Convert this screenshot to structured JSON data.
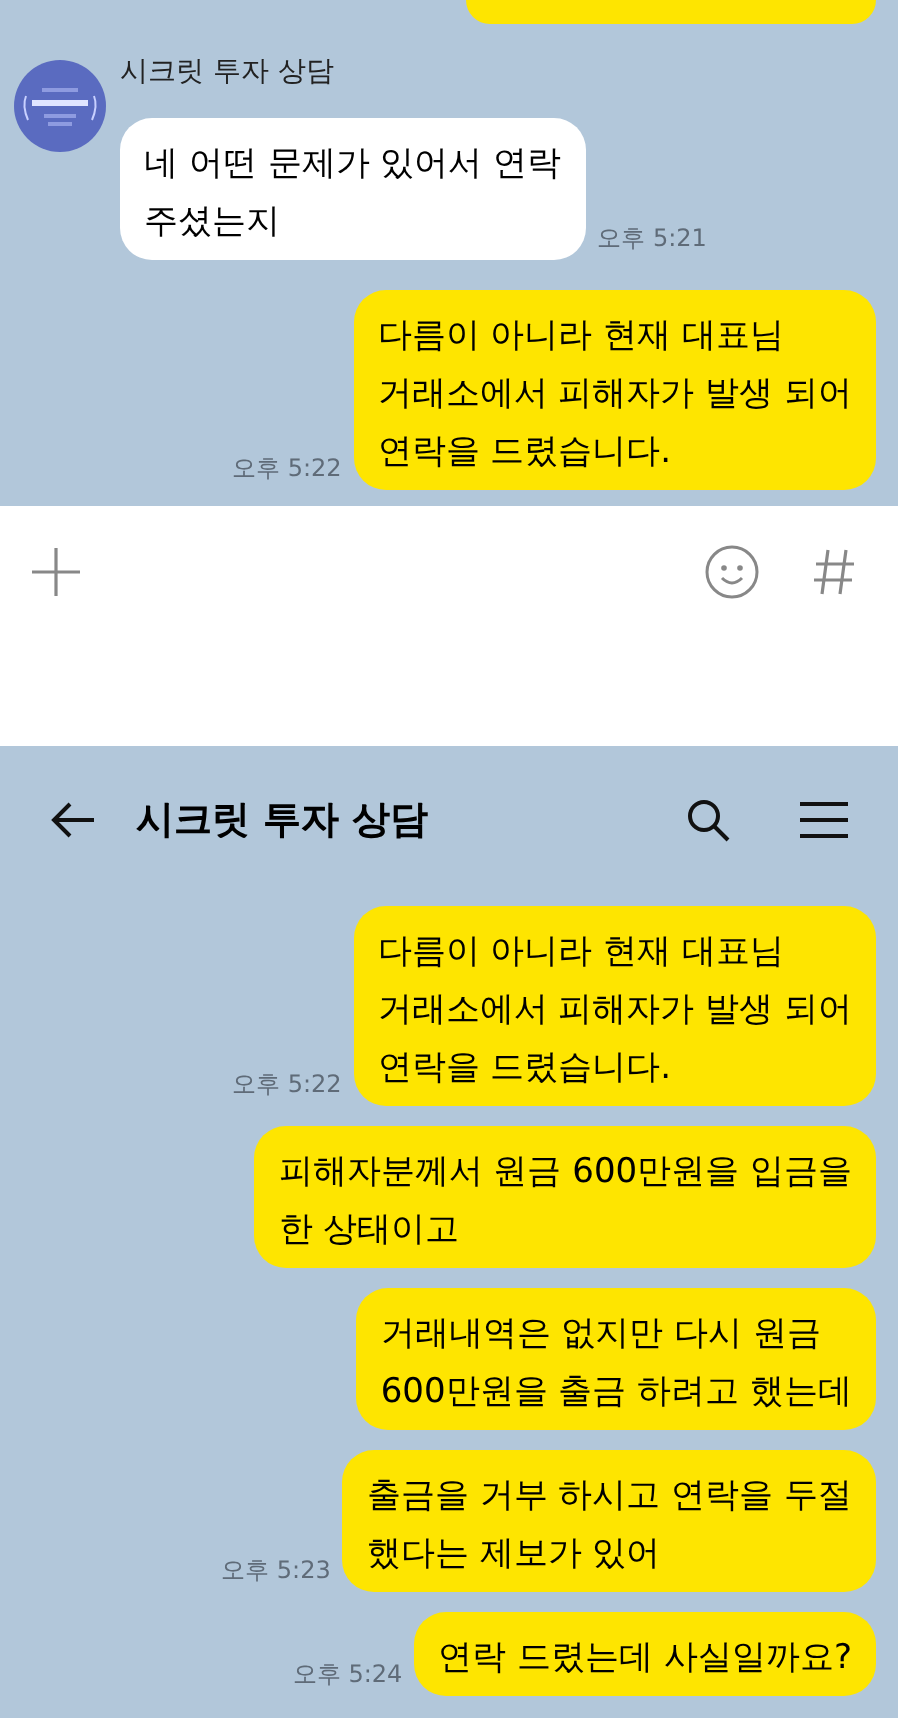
{
  "top_screen": {
    "messages": [
      {
        "kind": "received",
        "sender": "시크릿 투자 상담",
        "text": "네 어떤 문제가 있어서 연락\n주셨는지",
        "time": "오후 5:21"
      },
      {
        "kind": "sent",
        "text": "다름이 아니라 현재 대표님\n거래소에서 피해자가 발생 되어\n연락을 드렸습니다.",
        "time": "오후 5:22"
      }
    ]
  },
  "bottom_screen": {
    "header": {
      "title": "시크릿 투자 상담"
    },
    "messages": [
      {
        "kind": "sent",
        "text": "다름이 아니라 현재 대표님\n거래소에서 피해자가 발생 되어\n연락을 드렸습니다.",
        "time": "오후 5:22"
      },
      {
        "kind": "sent",
        "text": "피해자분께서 원금 600만원을 입금을\n한 상태이고"
      },
      {
        "kind": "sent",
        "text": "거래내역은 없지만 다시 원금\n600만원을 출금 하려고 했는데"
      },
      {
        "kind": "sent",
        "text": "출금을 거부 하시고 연락을 두절\n했다는 제보가 있어",
        "time": "오후 5:23"
      },
      {
        "kind": "sent",
        "text": "연락 드렸는데 사실일까요?",
        "time": "오후 5:24"
      }
    ]
  }
}
